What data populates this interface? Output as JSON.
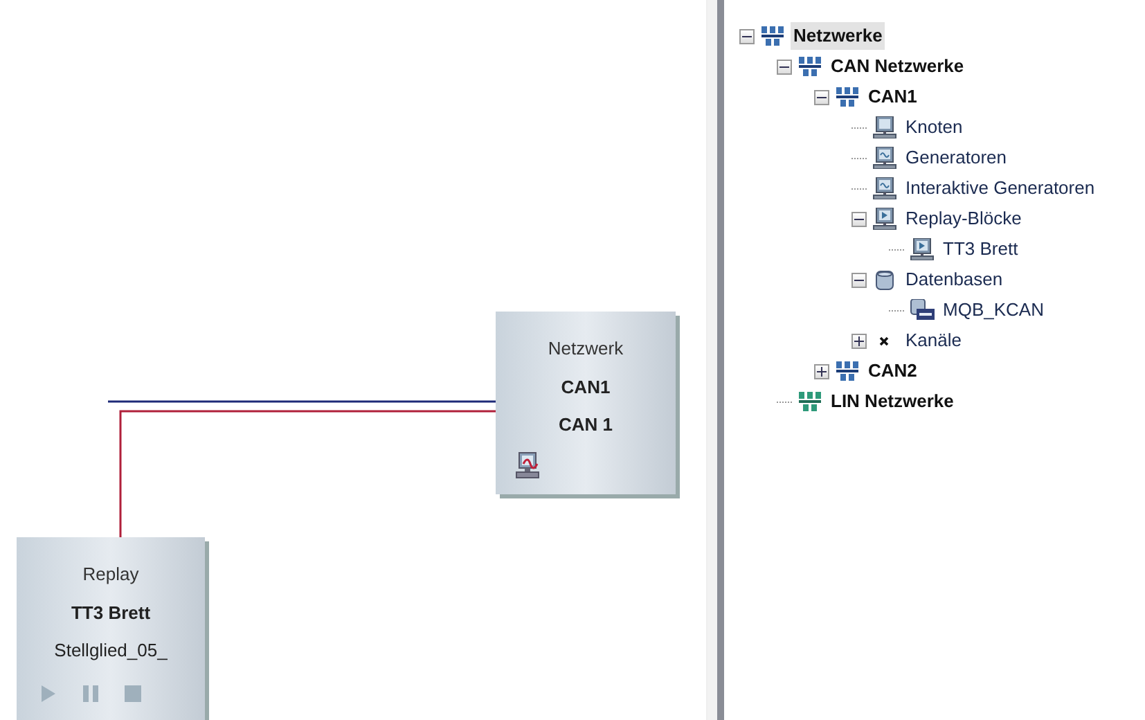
{
  "canvas": {
    "blocks": [
      {
        "kind": "network",
        "title": "Netzwerk",
        "name": "CAN1",
        "subtitle": "CAN 1"
      },
      {
        "kind": "replay",
        "title": "Replay",
        "name": "TT3 Brett",
        "subtitle": "Stellglied_05_"
      }
    ]
  },
  "tree": [
    {
      "label": "Netzwerke",
      "kind": "network",
      "selected": true,
      "expanded": true,
      "children": [
        {
          "label": "CAN Netzwerke",
          "kind": "network",
          "selected": false,
          "expanded": true,
          "children": [
            {
              "label": "CAN1",
              "kind": "network",
              "selected": false,
              "expanded": true,
              "children": [
                {
                  "label": "Knoten",
                  "kind": "node",
                  "selected": false
                },
                {
                  "label": "Generatoren",
                  "kind": "generator",
                  "selected": false
                },
                {
                  "label": "Interaktive Generatoren",
                  "kind": "generator",
                  "selected": false
                },
                {
                  "label": "Replay-Blöcke",
                  "kind": "replay",
                  "selected": false,
                  "expanded": true,
                  "children": [
                    {
                      "label": "TT3 Brett",
                      "kind": "replay",
                      "selected": false
                    }
                  ]
                },
                {
                  "label": "Datenbasen",
                  "kind": "database",
                  "selected": false,
                  "expanded": true,
                  "children": [
                    {
                      "label": "MQB_KCAN",
                      "kind": "dbc",
                      "selected": false
                    }
                  ]
                },
                {
                  "label": "Kanäle",
                  "kind": "channel",
                  "selected": false,
                  "expanded": false
                }
              ]
            },
            {
              "label": "CAN2",
              "kind": "network",
              "selected": false,
              "expanded": false
            }
          ]
        },
        {
          "label": "LIN Netzwerke",
          "kind": "lin",
          "selected": false
        }
      ]
    }
  ]
}
